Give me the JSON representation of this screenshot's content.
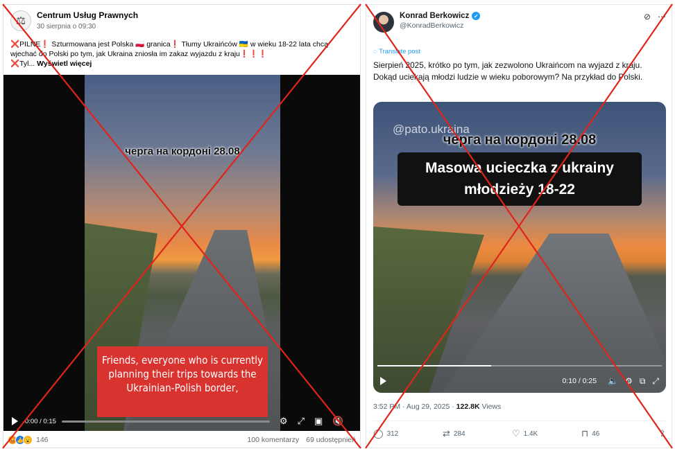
{
  "facebook": {
    "page_name": "Centrum Usług Prawnych",
    "date": "30 sierpnia o 09:30",
    "text_lines": [
      "❌PILNE❗ Szturmowana jest Polska 🇵🇱 granica❗ Tłumy Ukraińców 🇺🇦 w wieku 18-22 lata chcą",
      "wjechać do Polski po tym, jak Ukraina zniosła im zakaz wyjazdu z kraju❗❗❗"
    ],
    "text_more_prefix": "❌Tyl...",
    "see_more": "Wyświetl więcej",
    "video_caption_top": "черга на кордоні 28.08",
    "video_caption_red": "Friends, everyone who is currently planning their trips towards the Ukrainian-Polish border,",
    "video_time": "0:00 / 0:15",
    "reaction_count": "146",
    "comments": "100 komentarzy",
    "shares": "69 udostępnień",
    "reaction_colors": [
      "#f0a31d",
      "#1877f2",
      "#f7b125"
    ]
  },
  "twitter": {
    "name": "Konrad Berkowicz",
    "handle": "@KonradBerkowicz",
    "translate": "Translate post",
    "text": "Sierpień 2025, krótko po tym, jak zezwolono Ukraińcom na wyjazd z kraju. Dokąd uciekają młodzi ludzie w wieku poborowym? Na przykład do Polski.",
    "video_watermark": "@pato.ukraina",
    "video_caption_top": "черга на кордоні 28.08",
    "video_caption_box_line1": "Masowa ucieczka z ukrainy",
    "video_caption_box_line2": "młodzieży 18-22",
    "video_time": "0:10 / 0:25",
    "time": "3:52 PM · Aug 29, 2025 · ",
    "views": "122.8K",
    "views_label": " Views",
    "replies": "312",
    "reposts": "284",
    "likes": "1.4K",
    "bookmarks": "46",
    "verified_color": "#1d9bf0",
    "progress_fraction": 0.4
  },
  "overlay": {
    "cross_color": "#e0241b"
  }
}
